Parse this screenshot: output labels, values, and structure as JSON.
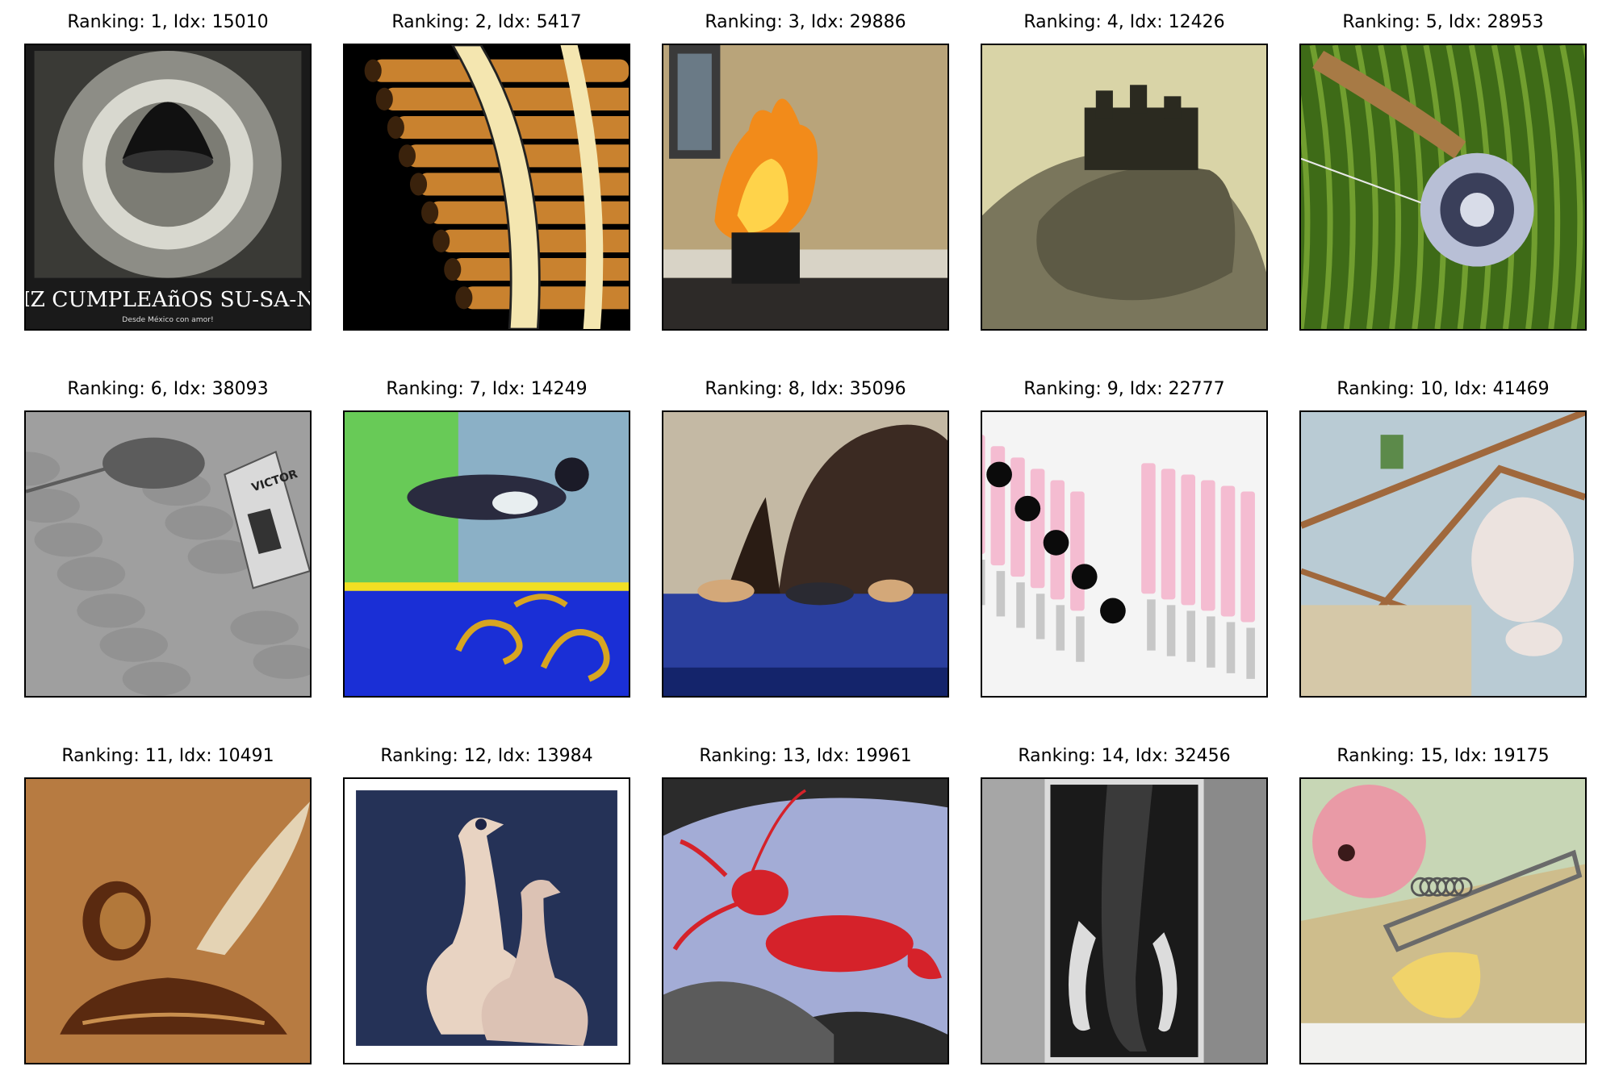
{
  "figure": {
    "cells": [
      {
        "title": "Ranking: 1, Idx: 15010",
        "image": "sombrero-birthday-card",
        "caption_text": "FELIZ CUMPLEAñOS SU-SA-NI-TA",
        "caption_subtext": "Desde México con amor!",
        "palette": [
          "#1a1a1a",
          "#8d8d86",
          "#d8d8cf"
        ]
      },
      {
        "title": "Ranking: 2, Idx: 5417",
        "image": "pan-flute",
        "palette": [
          "#000000",
          "#c9822f",
          "#f4e6b0"
        ]
      },
      {
        "title": "Ranking: 3, Idx: 29886",
        "image": "torch-flame",
        "palette": [
          "#b9a47a",
          "#f28b1a",
          "#2d2a28"
        ]
      },
      {
        "title": "Ranking: 4, Idx: 12426",
        "image": "castle-on-hill",
        "palette": [
          "#d9d4a7",
          "#5d5a45",
          "#2b2a20"
        ]
      },
      {
        "title": "Ranking: 5, Idx: 28953",
        "image": "fishing-reel-on-grass",
        "palette": [
          "#3e6b17",
          "#88b43a",
          "#b8bfd6"
        ]
      },
      {
        "title": "Ranking: 6, Idx: 38093",
        "image": "mouse-and-trap",
        "trap_text": "VICTOR",
        "palette": [
          "#9f9f9f",
          "#5c5c5c",
          "#d9d9d9"
        ]
      },
      {
        "title": "Ranking: 7, Idx: 14249",
        "image": "magpie-painting",
        "palette": [
          "#5fd13b",
          "#1a2fd6",
          "#d7a521"
        ]
      },
      {
        "title": "Ranking: 8, Idx: 35096",
        "image": "mice-on-blue-ledge",
        "palette": [
          "#2a3f9e",
          "#3b2a22",
          "#d3a879"
        ]
      },
      {
        "title": "Ranking: 9, Idx: 22777",
        "image": "pink-beaded-pins",
        "palette": [
          "#f4bcd1",
          "#0b0b0b",
          "#c7c7c7"
        ]
      },
      {
        "title": "Ranking: 10, Idx: 41469",
        "image": "baby-in-trap",
        "palette": [
          "#b9cbd4",
          "#a0683c",
          "#ece3df"
        ]
      },
      {
        "title": "Ranking: 11, Idx: 10491",
        "image": "inkwell-and-quill",
        "palette": [
          "#a86a32",
          "#5a2a10",
          "#e4d3b4"
        ]
      },
      {
        "title": "Ranking: 12, Idx: 13984",
        "image": "ostrich-polaroid",
        "palette": [
          "#1d2446",
          "#e8d3c2",
          "#3e5d8a"
        ]
      },
      {
        "title": "Ranking: 13, Idx: 19961",
        "image": "lobster-embroidery",
        "palette": [
          "#a3acd6",
          "#d5222a",
          "#2b2b2b"
        ]
      },
      {
        "title": "Ranking: 14, Idx: 32456",
        "image": "elephant-tusks",
        "palette": [
          "#8c8c8c",
          "#1a1a1a",
          "#dcdcdc"
        ]
      },
      {
        "title": "Ranking: 15, Idx: 19175",
        "image": "mouse-trap-with-cheese",
        "palette": [
          "#c7d6b5",
          "#e99aa6",
          "#f0d36a"
        ]
      }
    ]
  }
}
